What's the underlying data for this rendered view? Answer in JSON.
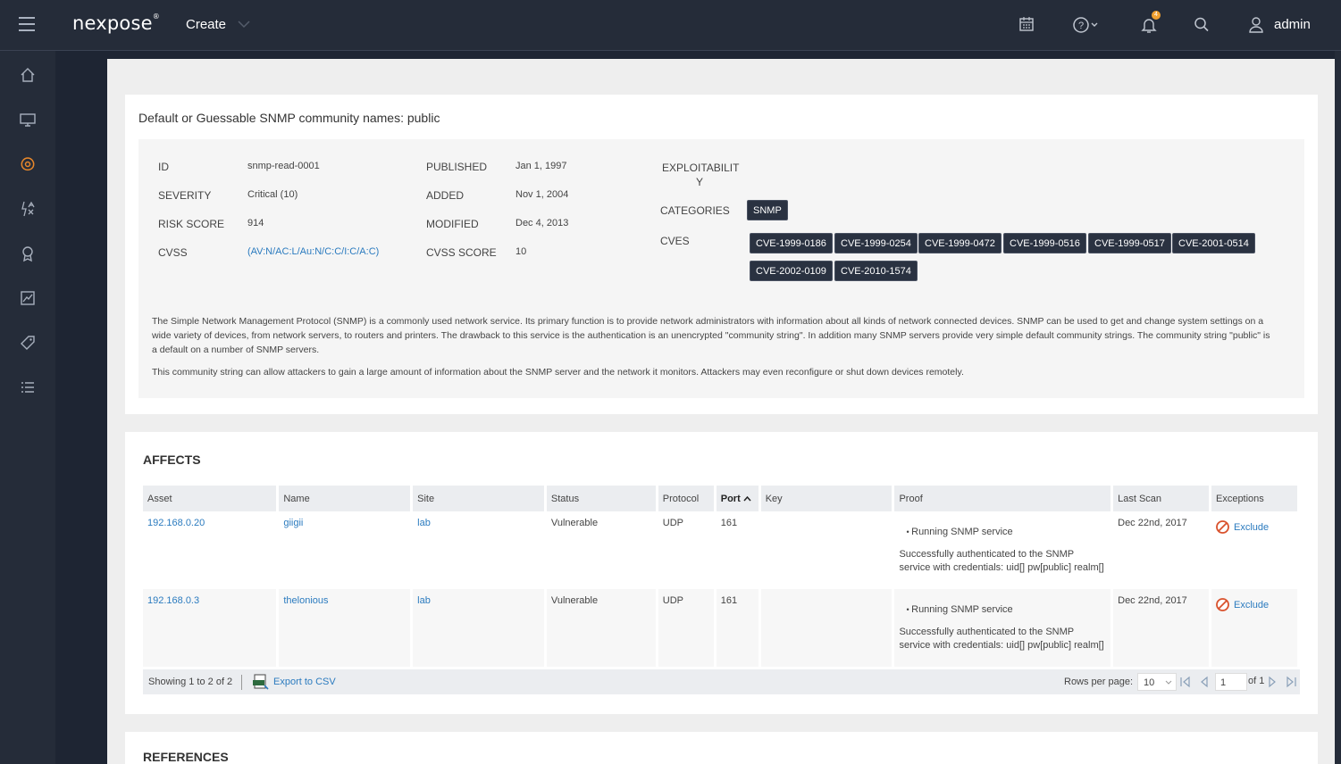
{
  "header": {
    "logo": "nexpose",
    "logo_mark": "®",
    "create_label": "Create",
    "user_name": "admin",
    "notification_count": "4",
    "icons": [
      "hamburger-icon",
      "calendar-icon",
      "help-icon",
      "bell-icon",
      "search-icon",
      "user-icon"
    ]
  },
  "sidebar": {
    "items": [
      "home-icon",
      "assets-icon",
      "vulnerabilities-icon",
      "policies-icon",
      "awards-icon",
      "reports-icon",
      "tags-icon",
      "list-icon"
    ],
    "active": "vulnerabilities-icon"
  },
  "vuln": {
    "title": "Default or Guessable SNMP community names: public",
    "id_label": "ID",
    "id": "snmp-read-0001",
    "severity_label": "SEVERITY",
    "severity": "Critical (10)",
    "risk_label": "RISK SCORE",
    "risk": "914",
    "cvss_label": "CVSS",
    "cvss": "(AV:N/AC:L/Au:N/C:C/I:C/A:C)",
    "published_label": "PUBLISHED",
    "published": "Jan 1, 1997",
    "added_label": "ADDED",
    "added": "Nov 1, 2004",
    "modified_label": "MODIFIED",
    "modified": "Dec 4, 2013",
    "cvss_score_label": "CVSS SCORE",
    "cvss_score": "10",
    "exploit_label_1": "EXPLOITABILIT",
    "exploit_label_2": "Y",
    "categories_label": "CATEGORIES",
    "category": "SNMP",
    "cves_label": "CVES",
    "cves": [
      "CVE-1999-0186",
      "CVE-1999-0254",
      "CVE-1999-0472",
      "CVE-1999-0516",
      "CVE-1999-0517",
      "CVE-2001-0514",
      "CVE-2002-0109",
      "CVE-2010-1574"
    ],
    "desc1": "The Simple Network Management Protocol (SNMP) is a commonly used network service. Its primary function is to provide network administrators with information about all kinds of network connected devices. SNMP can be used to get and change system settings on a wide variety of devices, from network servers, to routers and printers. The drawback to this service is the authentication is an unencrypted \"community string\". In addition many SNMP servers provide very simple default community strings. The community string \"public\" is a default on a number of SNMP servers.",
    "desc2": "This community string can allow attackers to gain a large amount of information about the SNMP server and the network it monitors. Attackers may even reconfigure or shut down devices remotely."
  },
  "affects": {
    "title": "AFFECTS",
    "columns": {
      "asset": "Asset",
      "name": "Name",
      "site": "Site",
      "status": "Status",
      "protocol": "Protocol",
      "port": "Port",
      "key": "Key",
      "proof": "Proof",
      "last_scan": "Last Scan",
      "exceptions": "Exceptions"
    },
    "rows": [
      {
        "asset": "192.168.0.20",
        "name": "giigii",
        "site": "lab",
        "status": "Vulnerable",
        "protocol": "UDP",
        "port": "161",
        "key": "",
        "proof_item": "Running SNMP service",
        "proof_text": "Successfully authenticated to the SNMP service with credentials: uid[] pw[public] realm[]",
        "last_scan": "Dec 22nd, 2017",
        "exception": "Exclude"
      },
      {
        "asset": "192.168.0.3",
        "name": "thelonious",
        "site": "lab",
        "status": "Vulnerable",
        "protocol": "UDP",
        "port": "161",
        "key": "",
        "proof_item": "Running SNMP service",
        "proof_text": "Successfully authenticated to the SNMP service with credentials: uid[] pw[public] realm[]",
        "last_scan": "Dec 22nd, 2017",
        "exception": "Exclude"
      }
    ],
    "showing": "Showing 1 to 2 of 2",
    "export_label": "Export to CSV",
    "rows_per_page_label": "Rows per page:",
    "rows_per_page": "10",
    "page": "1",
    "of_pages": "of 1"
  },
  "references": {
    "title": "REFERENCES"
  },
  "colors": {
    "topbar": "#252c39",
    "accent": "#f0a030",
    "link": "#2b7bbf",
    "chip": "#2a3241"
  }
}
